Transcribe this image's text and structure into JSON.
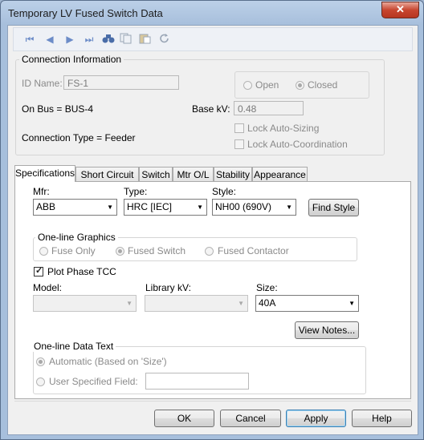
{
  "window": {
    "title": "Temporary LV Fused Switch Data",
    "close_glyph": "✕"
  },
  "toolbar": {
    "first": "⏮",
    "prev": "◀",
    "next": "▶",
    "last": "⏭",
    "icons": [
      "first-record-icon",
      "previous-record-icon",
      "next-record-icon",
      "last-record-icon",
      "binoculars-icon",
      "copy-icon",
      "paste-icon",
      "refresh-icon"
    ]
  },
  "connection": {
    "title": "Connection Information",
    "id_label": "ID Name:",
    "id_value": "FS-1",
    "open_label": "Open",
    "closed_label": "Closed",
    "state": "Closed",
    "on_bus": "On Bus =  BUS-4",
    "base_kv_label": "Base kV:",
    "base_kv_value": "0.48",
    "conn_type": "Connection Type =   Feeder",
    "lock_sizing": "Lock Auto-Sizing",
    "lock_coord": "Lock Auto-Coordination"
  },
  "tabs": [
    "Specifications",
    "Short Circuit",
    "Switch",
    "Mtr O/L",
    "Stability",
    "Appearance"
  ],
  "active_tab": "Specifications",
  "spec": {
    "mfr_label": "Mfr:",
    "mfr_value": "ABB",
    "type_label": "Type:",
    "type_value": "HRC [IEC]",
    "style_label": "Style:",
    "style_value": "NH00 (690V)",
    "find_style": "Find Style",
    "oneline_title": "One-line Graphics",
    "fuse_only": "Fuse Only",
    "fused_switch": "Fused Switch",
    "fused_contactor": "Fused Contactor",
    "plot_tcc": "Plot Phase TCC",
    "model_label": "Model:",
    "library_kv_label": "Library kV:",
    "size_label": "Size:",
    "size_value": "40A",
    "view_notes": "View Notes...",
    "data_text_title": "One-line Data Text",
    "automatic": "Automatic (Based on 'Size')",
    "user_field": "User Specified Field:"
  },
  "buttons": {
    "ok": "OK",
    "cancel": "Cancel",
    "apply": "Apply",
    "help": "Help"
  }
}
